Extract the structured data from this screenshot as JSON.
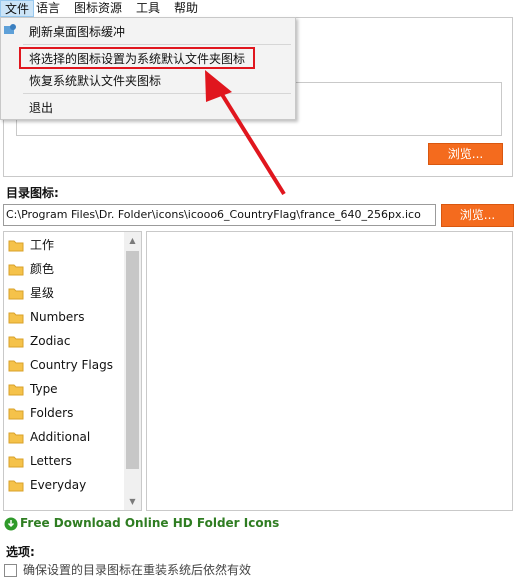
{
  "menubar": {
    "items": [
      "文件",
      "语言",
      "图标资源",
      "工具",
      "帮助"
    ]
  },
  "file_menu": {
    "items": [
      "刷新桌面图标缓冲",
      "将选择的图标设置为系统默认文件夹图标",
      "恢复系统默认文件夹图标",
      "退出"
    ],
    "highlighted_index": 1
  },
  "top_panel": {
    "browse_label": "浏览..."
  },
  "dir_icon": {
    "label": "目录图标:",
    "path": "C:\\Program Files\\Dr. Folder\\icons\\icooo6_CountryFlag\\france_640_256px.ico",
    "browse_label": "浏览..."
  },
  "categories": [
    "工作",
    "颜色",
    "星级",
    "Numbers",
    "Zodiac",
    "Country Flags",
    "Type",
    "Folders",
    "Additional",
    "Letters",
    "Everyday"
  ],
  "link": {
    "text": "Free Download Online HD Folder Icons"
  },
  "options": {
    "label": "选项:",
    "checkbox_text": "确保设置的目录图标在重装系统后依然有效"
  },
  "colors": {
    "accent_orange": "#f46b1e",
    "highlight_red": "#e0161e",
    "link_green": "#2f7d22"
  }
}
